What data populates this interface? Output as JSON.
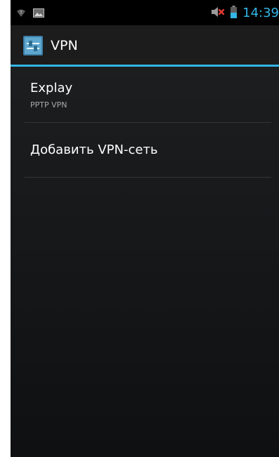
{
  "status_bar": {
    "time": "14:39",
    "icons": [
      "wifi-question-icon",
      "image-icon",
      "volume-muted-icon",
      "battery-icon"
    ]
  },
  "action_bar": {
    "title": "VPN",
    "icon": "vpn-settings-icon"
  },
  "vpn_list": [
    {
      "name": "Explay",
      "type": "PPTP VPN"
    }
  ],
  "add_vpn": {
    "label": "Добавить VPN-сеть"
  },
  "colors": {
    "accent": "#33b5e5",
    "background": "#17191b",
    "text_primary": "#ffffff",
    "text_secondary": "#a8a8a8",
    "muted_red": "#e53935"
  }
}
